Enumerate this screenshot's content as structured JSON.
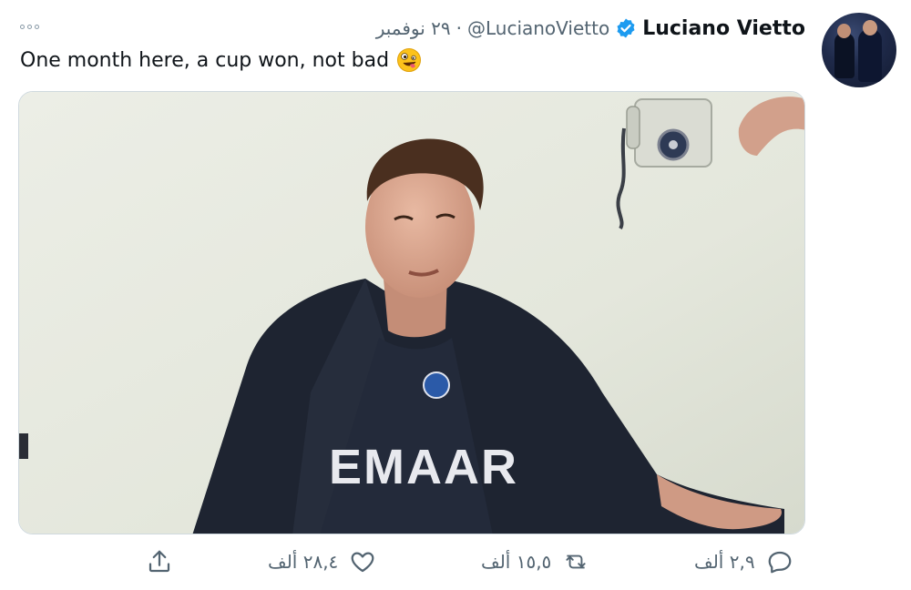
{
  "tweet": {
    "display_name": "Luciano Vietto",
    "handle": "@LucianoVietto",
    "separator": "·",
    "date": "٢٩ نوفمبر",
    "text": "One month here, a cup won, not bad",
    "emoji": "zany-face-emoji",
    "verified": true
  },
  "actions": {
    "reply_count": "٢,٩ ألف",
    "retweet_count": "١٥,٥ ألف",
    "like_count": "٢٨,٤ ألف"
  },
  "media": {
    "jersey_text": "EMAAR",
    "description_colors": {
      "wall": "#e6e8de",
      "jacket": "#1d2330",
      "skin": "#d7a48e"
    }
  },
  "colors": {
    "accent_verified": "#1d9bf0",
    "secondary_text": "#536471",
    "border": "#cfd9de"
  }
}
